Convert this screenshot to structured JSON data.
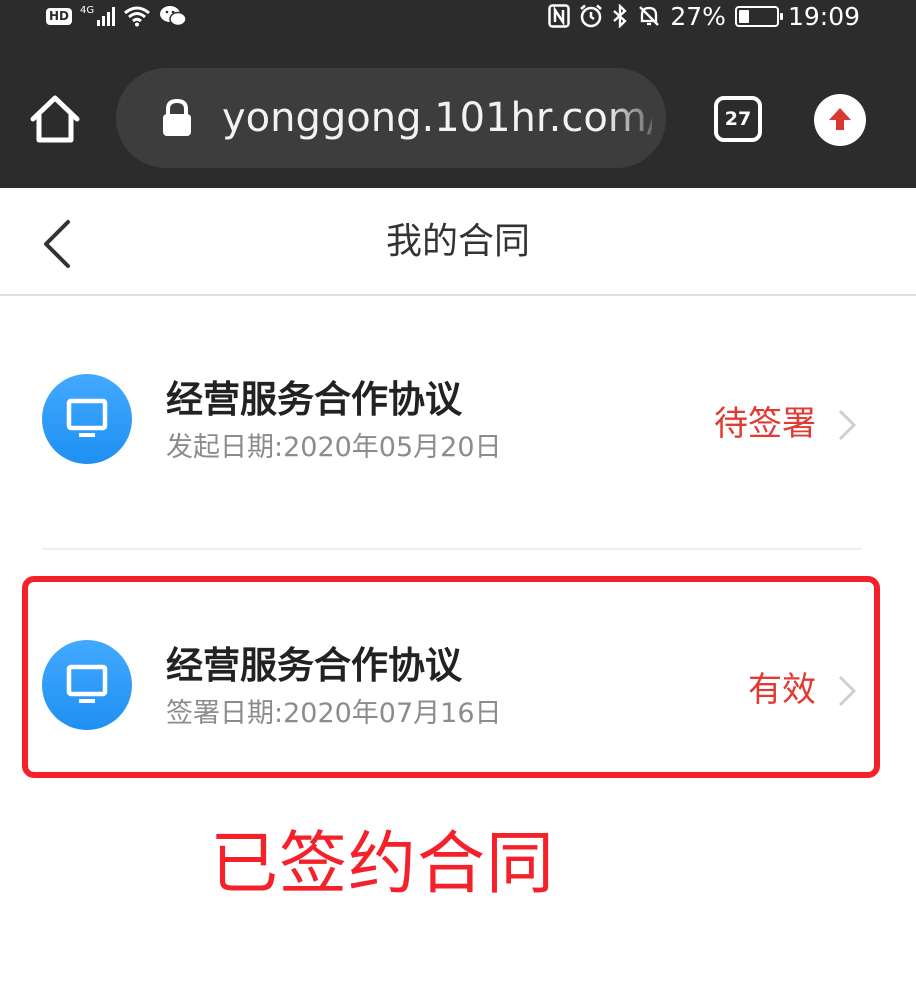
{
  "status_bar": {
    "hd": "HD",
    "network": "4G",
    "battery_level_percent": 27,
    "battery": "27%",
    "time": "19:09"
  },
  "browser": {
    "url": "yonggong.101hr.com/p",
    "tab_count": "27"
  },
  "page": {
    "title": "我的合同"
  },
  "contracts": [
    {
      "title": "经营服务合作协议",
      "date": "发起日期:2020年05月20日",
      "status": "待签署"
    },
    {
      "title": "经营服务合作协议",
      "date": "签署日期:2020年07月16日",
      "status": "有效"
    }
  ],
  "annotation": {
    "text": "已签约合同"
  },
  "colors": {
    "status_red": "#e13a32",
    "annotation_red": "#f4212b",
    "icon_blue": "#2a9bf7",
    "chrome_bg": "#2c2c2c"
  }
}
